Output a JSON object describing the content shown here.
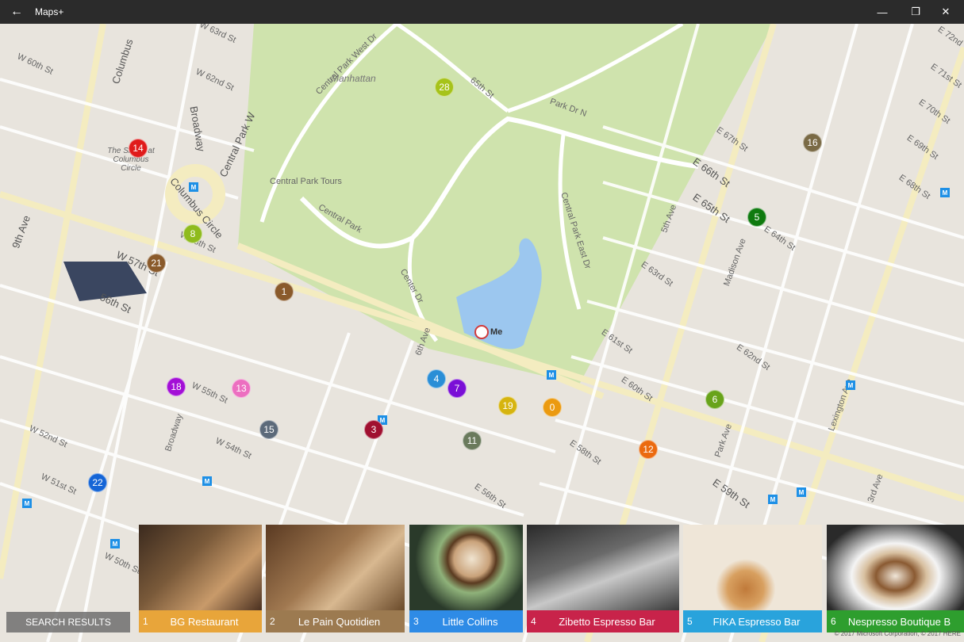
{
  "app": {
    "title": "Maps+"
  },
  "window": {
    "back_icon": "←",
    "minimize_icon": "—",
    "restore_icon": "❐",
    "close_icon": "✕"
  },
  "map": {
    "labels": {
      "manhattan": "Manhattan",
      "central_park_west_dr": "Central Park West Dr",
      "sixtyfifth": "65th St",
      "park_dr_n": "Park Dr N",
      "central_park_tours": "Central Park Tours",
      "central_park": "Central Park",
      "central_park_east_dr": "Central Park East Dr",
      "center_dr": "Center Dr",
      "fifth_ave": "5th Ave",
      "sixth_ave": "6th Ave",
      "madison_ave": "Madison Ave",
      "park_ave": "Park Ave",
      "lexington_ave": "Lexington Ave",
      "third_ave": "3rd Ave",
      "columbus": "Columbus",
      "broadway": "Broadway",
      "broadway2": "Broadway",
      "columbus_circle": "Columbus Circle",
      "central_park_w": "Central Park W",
      "ninth_ave": "9th Ave",
      "w57": "W 57th St",
      "w56": "56th St",
      "w60": "W 60th St",
      "w62": "W 62nd St",
      "w63": "W 63rd St",
      "w58": "W 58th St",
      "w55": "W 55th St",
      "w54": "W 54th St",
      "w52": "W 52nd St",
      "w51": "W 51st St",
      "w50": "W 50th St",
      "e72": "E 72nd",
      "e71": "E 71st St",
      "e70": "E 70th St",
      "e69": "E 69th St",
      "e68": "E 68th St",
      "e67": "E 67th St",
      "e66": "E 66th St",
      "e65": "E 65th St",
      "e64": "E 64th St",
      "e63": "E 63rd St",
      "e62": "E 62nd St",
      "e61": "E 61st St",
      "e60": "E 60th St",
      "e59": "E 59th St",
      "e58": "E 58th St",
      "e56": "E 56th St",
      "shops": "The Shops at Columbus Circle",
      "me": "Me"
    },
    "pins": [
      {
        "n": "28",
        "color": "#a6c31a"
      },
      {
        "n": "14",
        "color": "#e01b1b"
      },
      {
        "n": "16",
        "color": "#7a6a45"
      },
      {
        "n": "8",
        "color": "#8fbb1d"
      },
      {
        "n": "5",
        "color": "#0f7a0f"
      },
      {
        "n": "21",
        "color": "#8a5a2b"
      },
      {
        "n": "1",
        "color": "#8a5a2b"
      },
      {
        "n": "4",
        "color": "#2a8ed6"
      },
      {
        "n": "7",
        "color": "#7a0fd6"
      },
      {
        "n": "6",
        "color": "#68a31a"
      },
      {
        "n": "18",
        "color": "#a30fd6"
      },
      {
        "n": "13",
        "color": "#ec6fc0"
      },
      {
        "n": "19",
        "color": "#d6b40f"
      },
      {
        "n": "0",
        "color": "#eb9a10"
      },
      {
        "n": "15",
        "color": "#5c6a7a"
      },
      {
        "n": "3",
        "color": "#a01030"
      },
      {
        "n": "11",
        "color": "#6a7a5c"
      },
      {
        "n": "12",
        "color": "#eb6a10"
      },
      {
        "n": "22",
        "color": "#1565d6"
      }
    ]
  },
  "bottom": {
    "search_results": "SEARCH RESULTS",
    "cards": [
      {
        "num": "1",
        "name": "BG Restaurant",
        "color": "#e8a53a"
      },
      {
        "num": "2",
        "name": "Le Pain Quotidien",
        "color": "#9c7a50"
      },
      {
        "num": "3",
        "name": "Little Collins",
        "color": "#2e8be6"
      },
      {
        "num": "4",
        "name": "Zibetto Espresso Bar",
        "color": "#c8234a"
      },
      {
        "num": "5",
        "name": "FIKA Espresso Bar",
        "color": "#29a3dc"
      },
      {
        "num": "6",
        "name": "Nespresso Boutique B",
        "color": "#2e9e2e"
      }
    ]
  },
  "copyright": "© 2017 Microsoft Corporation, © 2017 HERE"
}
